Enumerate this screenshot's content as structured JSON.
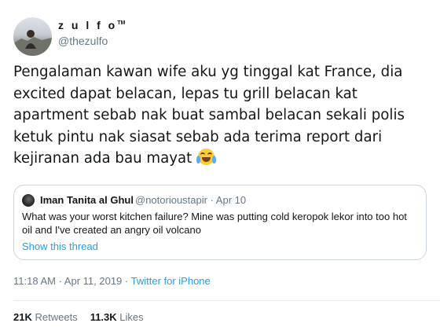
{
  "author": {
    "display_name": "z u l f o",
    "display_mark": "TM",
    "handle": "@thezulfo"
  },
  "tweet": {
    "text": "Pengalaman kawan wife aku yg tinggal kat France, dia excited dapat belacan, lepas tu grill belacan kat apartment sebab nak buat sambal belacan sekali polis ketuk pintu nak siasat sebab ada terima report dari kejiranan ada bau mayat",
    "emoji": "face-with-tears-of-joy"
  },
  "quoted_tweet": {
    "name": "Iman Tanita al Ghul",
    "handle_date": "@notorioustapir · Apr 10",
    "text": "What was your worst kitchen failure? Mine was putting cold keropok lekor into too hot oil and I've created an angry oil volcano",
    "show_thread_label": "Show this thread"
  },
  "meta": {
    "timestamp": "11:18 AM · Apr 11, 2019 · ",
    "source": "Twitter for iPhone"
  },
  "stats": {
    "retweets_count": "21K",
    "retweets_label": "Retweets",
    "likes_count": "11.3K",
    "likes_label": "Likes"
  },
  "colors": {
    "link": "#1da1f2",
    "secondary_text": "#657786",
    "border": "#ccd6dd"
  }
}
